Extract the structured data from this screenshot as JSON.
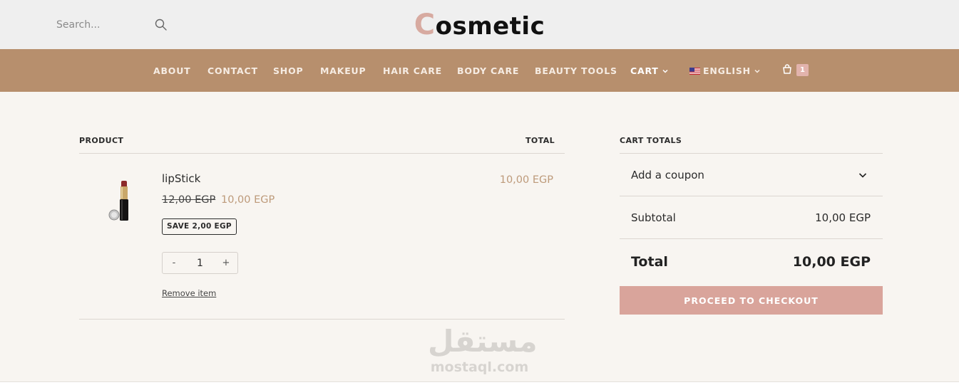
{
  "header": {
    "search": {
      "placeholder": "Search..."
    },
    "brand": {
      "first_letter": "C",
      "rest": "osmetic"
    }
  },
  "nav": {
    "items": [
      {
        "label": "ABOUT"
      },
      {
        "label": "CONTACT"
      },
      {
        "label": "SHOP"
      },
      {
        "label": "MAKEUP"
      },
      {
        "label": "HAIR CARE"
      },
      {
        "label": "BODY CARE"
      },
      {
        "label": "BEAUTY TOOLS"
      }
    ],
    "cart_label": "CART",
    "language_label": "ENGLISH",
    "cart_count": "1"
  },
  "cart": {
    "col_product": "PRODUCT",
    "col_total": "TOTAL",
    "item": {
      "name": "lipStick",
      "regular_price": "12,00 EGP",
      "sale_price": "10,00 EGP",
      "save_badge": "SAVE 2,00 EGP",
      "quantity": "1",
      "minus_label": "-",
      "plus_label": "+",
      "remove_label": "Remove item",
      "line_total": "10,00 EGP"
    }
  },
  "totals": {
    "heading": "CART TOTALS",
    "coupon_label": "Add a coupon",
    "subtotal_label": "Subtotal",
    "subtotal_value": "10,00 EGP",
    "total_label": "Total",
    "total_value": "10,00 EGP",
    "checkout_label": "PROCEED TO CHECKOUT"
  },
  "watermark": {
    "arabic": "مستقل",
    "latin": "mostaql.com"
  },
  "colors": {
    "nav_bg": "#b78f6d",
    "accent_price": "#bd9a7a",
    "checkout_bg": "#d9a49b",
    "brand_accent": "#d7aaa0",
    "page_bg": "#f8f5f1"
  }
}
